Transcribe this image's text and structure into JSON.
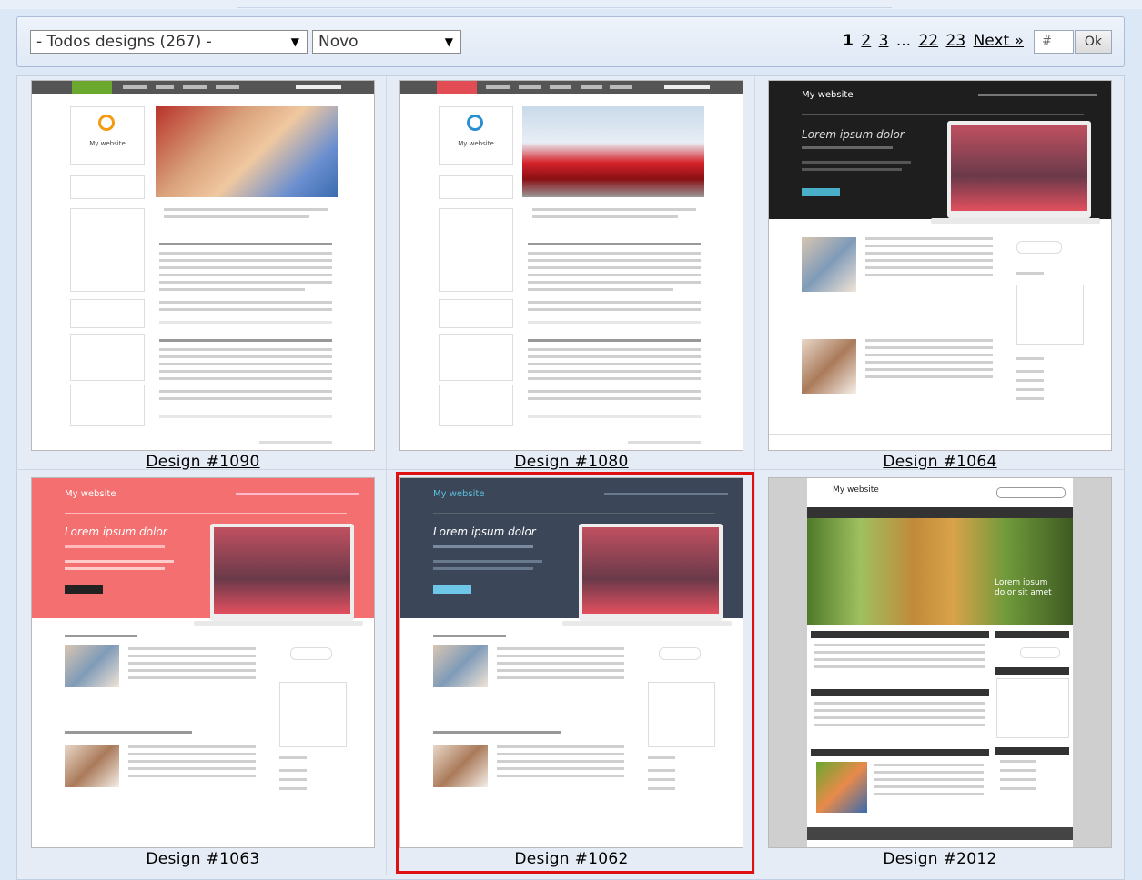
{
  "toolbar": {
    "category_select": "- Todos designs (267) -",
    "sort_select": "Novo",
    "pagination": {
      "current": "1",
      "pages": [
        "2",
        "3"
      ],
      "ellipsis": "...",
      "last_pages": [
        "22",
        "23"
      ],
      "next": "Next »"
    },
    "goto_placeholder": "#",
    "goto_button": "Ok"
  },
  "designs": [
    {
      "label": "Design #1090",
      "selected": false
    },
    {
      "label": "Design #1080",
      "selected": false
    },
    {
      "label": "Design #1064",
      "selected": false
    },
    {
      "label": "Design #1063",
      "selected": false
    },
    {
      "label": "Design #1062",
      "selected": true
    },
    {
      "label": "Design #2012",
      "selected": false
    }
  ],
  "thumb_text": {
    "site_title": "My website",
    "hero_heading": "Lorem ipsum dolor",
    "hero_heading_2012": "Lorem ipsum dolor sit amet"
  },
  "colors": {
    "selected_border": "#e01010",
    "accent_green": "#6aa82e",
    "accent_red": "#e14c55",
    "coral": "#f46f6f",
    "slate": "#3b4758",
    "dark": "#1e1e1e"
  }
}
